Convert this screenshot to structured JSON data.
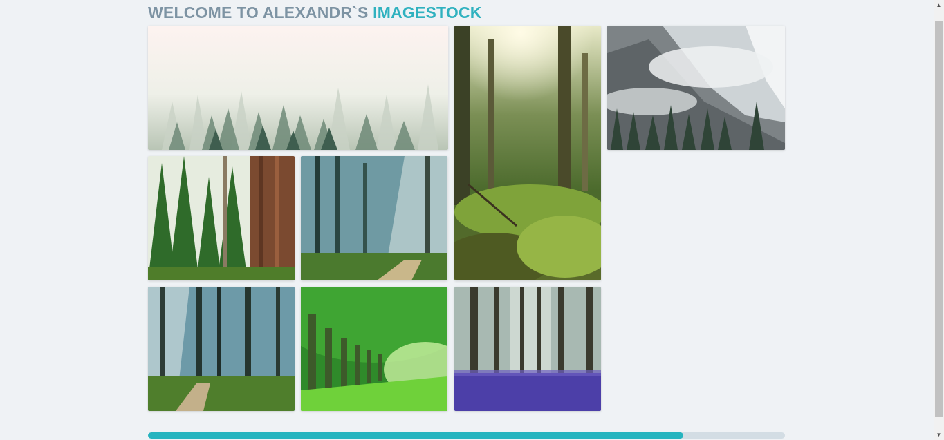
{
  "header": {
    "title_prefix": "WELCOME TO ALEXANDR`S ",
    "title_accent": "IMAGESTOCK"
  },
  "gallery": {
    "images": [
      {
        "subject": "foggy-pine-forest"
      },
      {
        "subject": "sunlit-forest-floor-moss"
      },
      {
        "subject": "misty-mountain-pines"
      },
      {
        "subject": "redwood-forest"
      },
      {
        "subject": "sunbeams-forest-path"
      },
      {
        "subject": "forest-trail-light-rays"
      },
      {
        "subject": "green-tree-tunnel"
      },
      {
        "subject": "bluebell-woods"
      }
    ]
  },
  "progress": {
    "value": 0.84
  },
  "colors": {
    "accent": "#2fb1bf",
    "title": "#7d93a3",
    "background": "#eff2f5"
  },
  "scrollbar": {
    "up_icon": "▲",
    "down_icon": "▼"
  }
}
